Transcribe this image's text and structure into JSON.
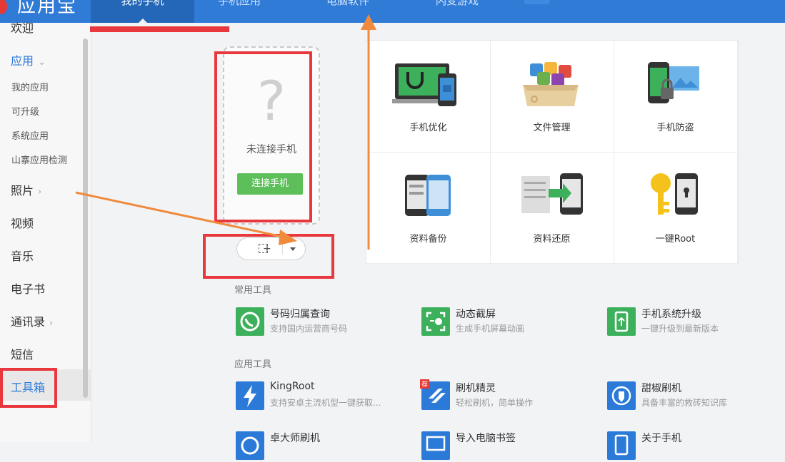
{
  "app": {
    "name": "应用宝"
  },
  "nav": {
    "tabs": [
      "我的手机",
      "手机应用",
      "电脑软件",
      "闪变游戏"
    ]
  },
  "sidebar": {
    "welcome": "欢迎",
    "apps": "应用",
    "sub": [
      "我的应用",
      "可升级",
      "系统应用",
      "山寨应用检测"
    ],
    "items": [
      "照片",
      "视频",
      "音乐",
      "电子书",
      "通讯录",
      "短信",
      "工具箱"
    ]
  },
  "phone": {
    "status": "未连接手机",
    "connect_label": "连接手机",
    "placeholder_glyph": "?"
  },
  "grid": [
    "手机优化",
    "文件管理",
    "手机防盗",
    "资料备份",
    "资料还原",
    "一键Root"
  ],
  "sections": {
    "common": "常用工具",
    "app_tools": "应用工具"
  },
  "tools_common": [
    {
      "name": "号码归属查询",
      "desc": "支持国内运营商号码",
      "icon": "phone-lookup-icon"
    },
    {
      "name": "动态截屏",
      "desc": "生成手机屏幕动画",
      "icon": "screen-capture-icon"
    },
    {
      "name": "手机系统升级",
      "desc": "一键升级到最新版本",
      "icon": "system-upgrade-icon"
    }
  ],
  "tools_app": [
    {
      "name": "KingRoot",
      "desc": "支持安卓主流机型一键获取...",
      "icon": "lightning-icon"
    },
    {
      "name": "刷机精灵",
      "desc": "轻松刷机，简单操作",
      "icon": "flash-elf-icon",
      "badge": "荐"
    },
    {
      "name": "甜椒刷机",
      "desc": "具备丰富的救砖知识库",
      "icon": "pepper-flash-icon"
    },
    {
      "name": "卓大师刷机",
      "desc": "",
      "icon": "master-flash-icon"
    },
    {
      "name": "导入电脑书签",
      "desc": "",
      "icon": "bookmark-import-icon"
    },
    {
      "name": "关于手机",
      "desc": "",
      "icon": "about-phone-icon"
    }
  ],
  "colors": {
    "topbar": "#2f7bd6",
    "accent": "#2b7ad8",
    "green": "#5cbf5a",
    "annotation_red": "#e8383d",
    "annotation_orange": "#f08a3c"
  }
}
